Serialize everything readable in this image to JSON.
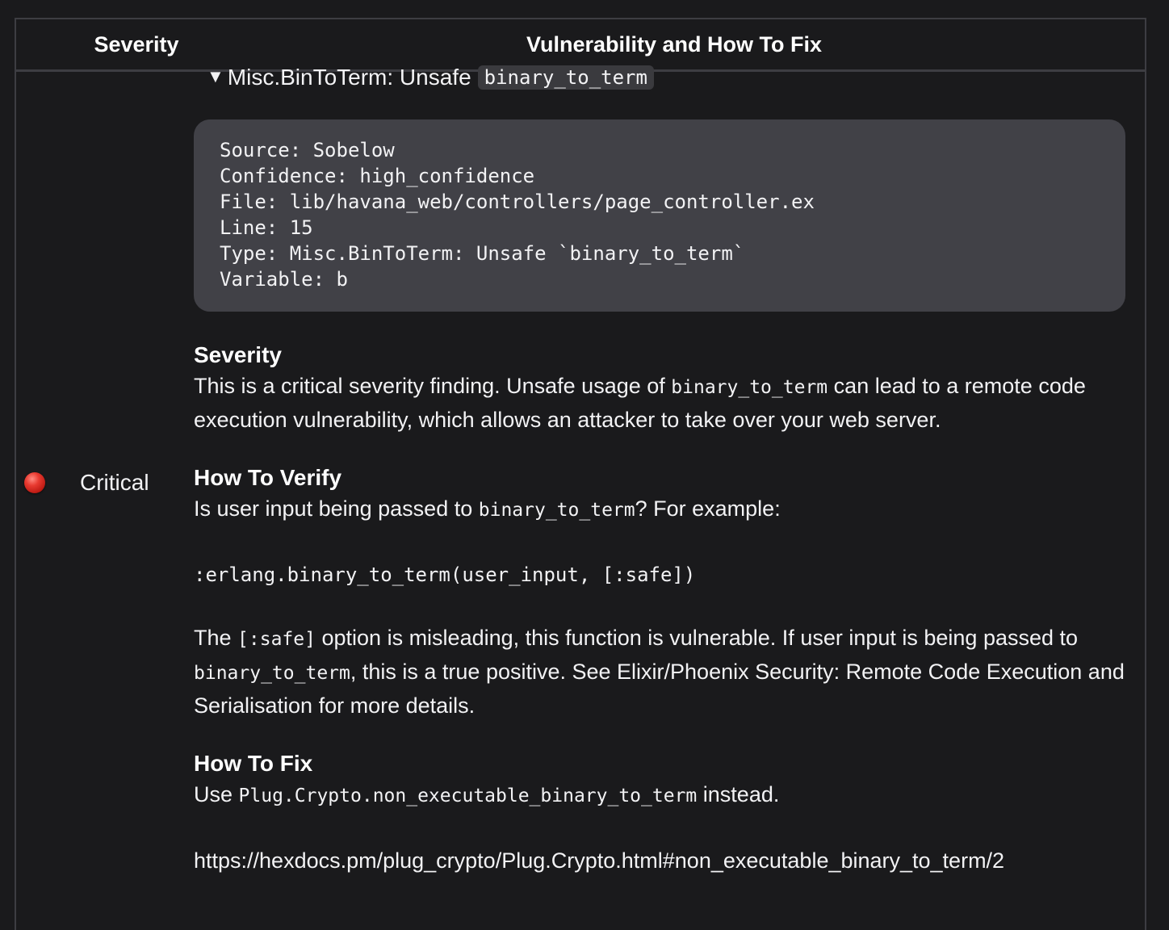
{
  "table": {
    "headers": {
      "severity": "Severity",
      "vulnerability": "Vulnerability and How To Fix"
    }
  },
  "row": {
    "severity": {
      "indicator_icon": "red-circle-icon",
      "indicator_color": "#e83a30",
      "label": "Critical"
    },
    "finding": {
      "disclosure_icon": "triangle-down-icon",
      "disclosure_glyph": "▼",
      "summary_text": "Misc.BinToTerm: Unsafe",
      "summary_code": "binary_to_term",
      "details": [
        "Source: Sobelow",
        "Confidence: high_confidence",
        "File: lib/havana_web/controllers/page_controller.ex",
        "Line: 15",
        "Type: Misc.BinToTerm: Unsafe `binary_to_term`",
        "Variable: b"
      ],
      "severity_section": {
        "title": "Severity",
        "text_1": "This is a critical severity finding. Unsafe usage of",
        "code_1": "binary_to_term",
        "text_2": "can lead to a remote code execution vulnerability, which allows an attacker to take over your web server."
      },
      "verify_section": {
        "title": "How To Verify",
        "text_1": "Is user input being passed to",
        "code_1": "binary_to_term",
        "text_2": "? For example:",
        "example_code": ":erlang.binary_to_term(user_input, [:safe])",
        "para2_text_1": "The",
        "para2_code_1": "[:safe]",
        "para2_text_2": "option is misleading, this function is vulnerable. If user input is being passed to",
        "para2_code_2": "binary_to_term",
        "para2_text_3": ", this is a true positive. See Elixir/Phoenix Security: Remote Code Execution and Serialisation for more details."
      },
      "fix_section": {
        "title": "How To Fix",
        "text_1": "Use",
        "code_1": "Plug.Crypto.non_executable_binary_to_term",
        "text_2": "instead.",
        "link": "https://hexdocs.pm/plug_crypto/Plug.Crypto.html#non_executable_binary_to_term/2"
      }
    }
  },
  "colors": {
    "background": "#1a1a1c",
    "border": "#3d3d42",
    "code_block_bg": "#414147",
    "inline_code_bg": "#3a3a3e",
    "text": "#f2f2f4"
  }
}
